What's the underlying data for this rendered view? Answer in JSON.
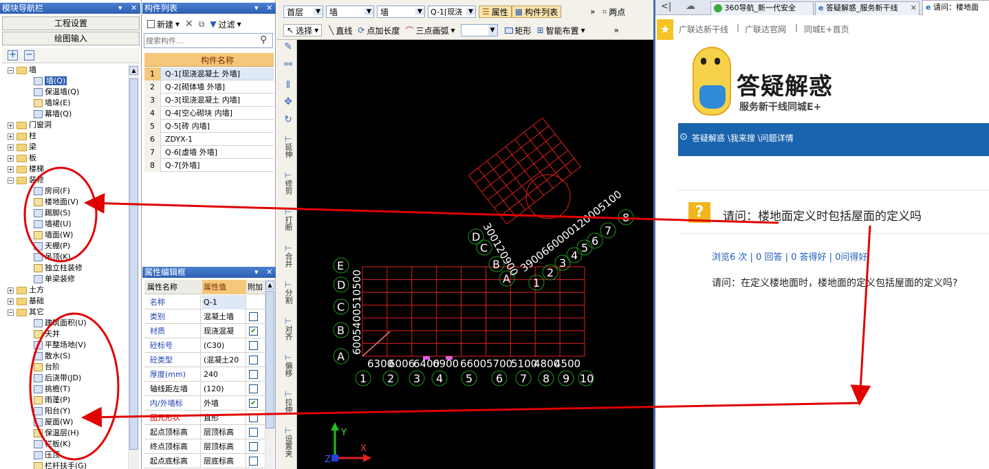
{
  "nav_panel": {
    "title": "模块导航栏",
    "pin": "▼ ✕",
    "btn_project": "工程设置",
    "btn_drawing": "绘图输入",
    "tree": [
      {
        "label": "墙",
        "type": "folder",
        "exp": "−",
        "level": 0
      },
      {
        "label": "墙(Q)",
        "type": "item",
        "level": 1,
        "selected": true
      },
      {
        "label": "保温墙(Q)",
        "type": "item",
        "level": 1
      },
      {
        "label": "墙垛(E)",
        "type": "item",
        "level": 1
      },
      {
        "label": "幕墙(Q)",
        "type": "item",
        "level": 1
      },
      {
        "label": "门窗洞",
        "type": "folder",
        "exp": "+",
        "level": 0
      },
      {
        "label": "柱",
        "type": "folder",
        "exp": "+",
        "level": 0
      },
      {
        "label": "梁",
        "type": "folder",
        "exp": "+",
        "level": 0
      },
      {
        "label": "板",
        "type": "folder",
        "exp": "+",
        "level": 0
      },
      {
        "label": "楼梯",
        "type": "folder",
        "exp": "+",
        "level": 0
      },
      {
        "label": "装修",
        "type": "folder",
        "exp": "−",
        "level": 0
      },
      {
        "label": "房间(F)",
        "type": "item",
        "level": 1
      },
      {
        "label": "楼地面(V)",
        "type": "item",
        "level": 1
      },
      {
        "label": "踢脚(S)",
        "type": "item",
        "level": 1
      },
      {
        "label": "墙裙(U)",
        "type": "item",
        "level": 1
      },
      {
        "label": "墙面(W)",
        "type": "item",
        "level": 1
      },
      {
        "label": "天棚(P)",
        "type": "item",
        "level": 1
      },
      {
        "label": "吊顶(K)",
        "type": "item",
        "level": 1
      },
      {
        "label": "独立柱装修",
        "type": "item",
        "level": 1
      },
      {
        "label": "单梁装修",
        "type": "item",
        "level": 1
      },
      {
        "label": "土方",
        "type": "folder",
        "exp": "+",
        "level": 0
      },
      {
        "label": "基础",
        "type": "folder",
        "exp": "+",
        "level": 0
      },
      {
        "label": "其它",
        "type": "folder",
        "exp": "−",
        "level": 0
      },
      {
        "label": "建筑面积(U)",
        "type": "item",
        "level": 1
      },
      {
        "label": "天井",
        "type": "item",
        "level": 1
      },
      {
        "label": "平整场地(V)",
        "type": "item",
        "level": 1
      },
      {
        "label": "散水(S)",
        "type": "item",
        "level": 1
      },
      {
        "label": "台阶",
        "type": "item",
        "level": 1
      },
      {
        "label": "后浇带(JD)",
        "type": "item",
        "level": 1
      },
      {
        "label": "挑檐(T)",
        "type": "item",
        "level": 1
      },
      {
        "label": "雨蓬(P)",
        "type": "item",
        "level": 1
      },
      {
        "label": "阳台(Y)",
        "type": "item",
        "level": 1
      },
      {
        "label": "屋面(W)",
        "type": "item",
        "level": 1
      },
      {
        "label": "保温层(H)",
        "type": "item",
        "level": 1
      },
      {
        "label": "栏板(K)",
        "type": "item",
        "level": 1
      },
      {
        "label": "压顶",
        "type": "item",
        "level": 1
      },
      {
        "label": "栏杆扶手(G)",
        "type": "item",
        "level": 1
      }
    ]
  },
  "component_list": {
    "title": "构件列表",
    "btn_new": "新建",
    "btn_filter": "过滤",
    "search_placeholder": "搜索构件...",
    "header": "构件名称",
    "rows": [
      {
        "n": "1",
        "name": "Q-1[现浇混凝土 外墙]"
      },
      {
        "n": "2",
        "name": "Q-2[砌体墙 外墙]"
      },
      {
        "n": "3",
        "name": "Q-3[现浇混凝土 内墙]"
      },
      {
        "n": "4",
        "name": "Q-4[空心砌块 内墙]"
      },
      {
        "n": "5",
        "name": "Q-5[砖 内墙]"
      },
      {
        "n": "6",
        "name": "ZDYX-1"
      },
      {
        "n": "7",
        "name": "Q-6[虚墙 外墙]"
      },
      {
        "n": "8",
        "name": "Q-7[外墙]"
      }
    ]
  },
  "property_editor": {
    "title": "属性编辑框",
    "col_name": "属性名称",
    "col_value": "属性值",
    "col_extra": "附加",
    "rows": [
      {
        "k": "名称",
        "v": "Q-1",
        "cb": null,
        "color": "blue"
      },
      {
        "k": "类别",
        "v": "混凝土墙",
        "cb": false,
        "color": "blue"
      },
      {
        "k": "材质",
        "v": "现浇混凝",
        "cb": true,
        "color": "blue"
      },
      {
        "k": "砼标号",
        "v": "(C30)",
        "cb": false,
        "color": "blue"
      },
      {
        "k": "砼类型",
        "v": "(混凝土20",
        "cb": false,
        "color": "blue"
      },
      {
        "k": "厚度(mm)",
        "v": "240",
        "cb": false,
        "color": "blue"
      },
      {
        "k": "轴线距左墙",
        "v": "(120)",
        "cb": false,
        "color": "black"
      },
      {
        "k": "内/外墙标",
        "v": "外墙",
        "cb": true,
        "color": "blue"
      },
      {
        "k": "图元形状",
        "v": "直形",
        "cb": false,
        "color": "red"
      },
      {
        "k": "起点顶标高",
        "v": "层顶标高",
        "cb": false,
        "color": "black"
      },
      {
        "k": "终点顶标高",
        "v": "层顶标高",
        "cb": false,
        "color": "black"
      },
      {
        "k": "起点底标高",
        "v": "层底标高",
        "cb": false,
        "color": "black"
      }
    ]
  },
  "toolbar": {
    "floor": "首层",
    "type1": "墙",
    "type2": "墙",
    "comp": "Q-1[现浇",
    "btn_props": "属性",
    "btn_complist": "构件列表",
    "btn_twopoint": "两点",
    "btn_select": "选择",
    "btn_line": "直线",
    "btn_point_len": "点加长度",
    "btn_arc": "三点画弧",
    "btn_rect": "矩形",
    "btn_smart": "智能布置",
    "more": "»"
  },
  "vertical_tools": [
    "延伸",
    "修剪",
    "打断",
    "合并",
    "分割",
    "对齐",
    "偏移",
    "拉伸",
    "设置夹"
  ],
  "cad": {
    "row_axes": [
      "A",
      "B",
      "C",
      "D",
      "E"
    ],
    "row_dims": "6005400510500",
    "col_axes": [
      "1",
      "2",
      "3",
      "4",
      "5",
      "6",
      "7",
      "8",
      "9",
      "10"
    ],
    "col_dims": [
      "6300",
      "6006",
      "6400",
      "6900",
      "6600",
      "5700",
      "5100",
      "4800",
      "4500"
    ],
    "rot_axes_row": [
      "A",
      "B",
      "C",
      "D"
    ],
    "rot_axes_col": [
      "1",
      "2",
      "3",
      "4",
      "5",
      "6",
      "7",
      "8"
    ],
    "rot_dims_a": "300120900",
    "rot_dims_b": "3900660000120005100",
    "axis_y": "Y",
    "axis_x": "X",
    "axis_z": "Z"
  },
  "browser": {
    "tabs": [
      "360导航_新一代安全",
      "答疑解惑_服务新干线",
      "请问：楼地面"
    ],
    "favs": [
      "广联达新干线",
      "广联达官网",
      "同城E+首页"
    ],
    "site_title": "答疑解惑",
    "site_sub": "服务新干线同城E+",
    "breadcrumb": "答疑解惑 \\我来搜 \\问题详情",
    "question": "请问：楼地面定义时包括屋面的定义吗",
    "stats": "浏览6 次 | 0 回答 | 0 答得好 | 0问得好",
    "body": "请问：在定义楼地面时，楼地面的定义包括屋面的定义吗?",
    "qmark": "?"
  },
  "colors": {
    "annot_red": "#e00000",
    "cad_red": "#e02020",
    "cad_green": "#1d9a1d",
    "browser_blue": "#1a64ae"
  }
}
